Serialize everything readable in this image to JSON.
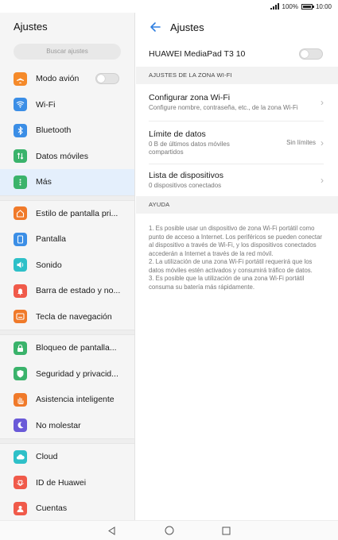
{
  "status_bar": {
    "battery": "100%",
    "time": "10:00"
  },
  "left": {
    "title": "Ajustes",
    "search_placeholder": "Buscar ajustes",
    "groups": [
      [
        {
          "label": "Modo avión",
          "icon": "airplane-icon",
          "color": "#f58a2a",
          "toggle": true
        },
        {
          "label": "Wi-Fi",
          "icon": "wifi-icon",
          "color": "#3b8ee6"
        },
        {
          "label": "Bluetooth",
          "icon": "bluetooth-icon",
          "color": "#3b8ee6"
        },
        {
          "label": "Datos móviles",
          "icon": "mobile-data-icon",
          "color": "#3ab36b"
        },
        {
          "label": "Más",
          "icon": "more-icon",
          "color": "#3ab36b",
          "selected": true
        }
      ],
      [
        {
          "label": "Estilo de pantalla pri...",
          "icon": "home-style-icon",
          "color": "#f07a2a"
        },
        {
          "label": "Pantalla",
          "icon": "display-icon",
          "color": "#3b8ee6"
        },
        {
          "label": "Sonido",
          "icon": "sound-icon",
          "color": "#2ec0c8"
        },
        {
          "label": "Barra de estado y no...",
          "icon": "notification-icon",
          "color": "#f05a4a"
        },
        {
          "label": "Tecla de navegación",
          "icon": "navigation-key-icon",
          "color": "#f07a2a"
        }
      ],
      [
        {
          "label": "Bloqueo de pantalla...",
          "icon": "lock-icon",
          "color": "#3ab36b"
        },
        {
          "label": "Seguridad y privacid...",
          "icon": "shield-icon",
          "color": "#3ab36b"
        },
        {
          "label": "Asistencia inteligente",
          "icon": "hand-icon",
          "color": "#f07a2a"
        },
        {
          "label": "No molestar",
          "icon": "moon-icon",
          "color": "#6a5ad8"
        }
      ],
      [
        {
          "label": "Cloud",
          "icon": "cloud-icon",
          "color": "#2ec0c8"
        },
        {
          "label": "ID de Huawei",
          "icon": "huawei-id-icon",
          "color": "#f05a4a"
        },
        {
          "label": "Cuentas",
          "icon": "accounts-icon",
          "color": "#f05a4a"
        }
      ]
    ]
  },
  "right": {
    "title": "Ajustes",
    "hotspot_name": "HUAWEI MediaPad T3 10",
    "section_title": "AJUSTES DE LA ZONA WI-FI",
    "items": [
      {
        "title": "Configurar zona Wi-Fi",
        "subtitle": "Configure nombre, contraseña, etc., de la zona Wi-Fi",
        "value": ""
      },
      {
        "title": "Límite de datos",
        "subtitle": "0 B de últimos datos móviles compartidos",
        "value": "Sin límites"
      },
      {
        "title": "Lista de dispositivos",
        "subtitle": "0 dispositivos conectados",
        "value": ""
      }
    ],
    "help_title": "AYUDA",
    "help_text": "1. Es posible usar un dispositivo de zona Wi-Fi portátil como punto de acceso a Internet. Los periféricos se pueden conectar al dispositivo a través de Wi-Fi, y los dispositivos conectados accederán a Internet a través de la red móvil.\n2. La utilización de una zona Wi-Fi portátil requerirá que los datos móviles estén activados y consumirá tráfico de datos.\n3. Es posible que la utilización de una zona Wi-Fi portátil consuma su batería más rápidamente."
  },
  "accent_color": "#2f7fe0"
}
